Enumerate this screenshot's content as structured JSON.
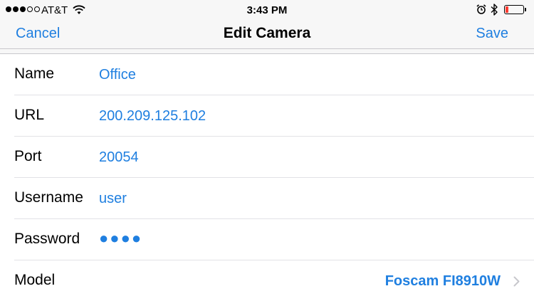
{
  "status_bar": {
    "carrier": "AT&T",
    "time": "3:43 PM",
    "signal_bars_filled": 3,
    "signal_bars_total": 5,
    "battery_level": 0.15,
    "icons": [
      "signal-dots",
      "wifi-icon",
      "alarm-icon",
      "bluetooth-icon",
      "battery-icon"
    ]
  },
  "nav": {
    "cancel_label": "Cancel",
    "title": "Edit Camera",
    "save_label": "Save"
  },
  "form": {
    "name": {
      "label": "Name",
      "value": "Office"
    },
    "url": {
      "label": "URL",
      "value": "200.209.125.102"
    },
    "port": {
      "label": "Port",
      "value": "20054"
    },
    "username": {
      "label": "Username",
      "value": "user"
    },
    "password": {
      "label": "Password",
      "value": "●●●●"
    },
    "model": {
      "label": "Model",
      "value": "Foscam FI8910W"
    }
  },
  "colors": {
    "accent": "#1f7fe0",
    "battery_low": "#ff3b30",
    "background": "#f7f7f7"
  }
}
